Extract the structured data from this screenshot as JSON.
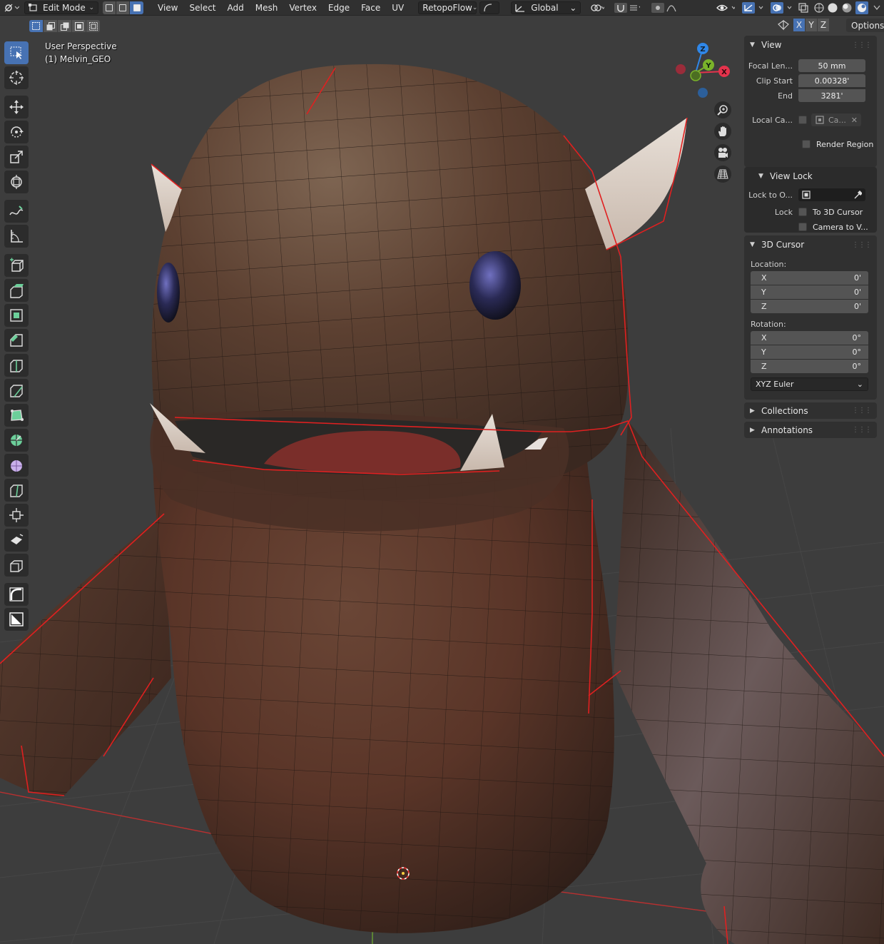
{
  "header": {
    "mode_label": "Edit Mode",
    "menus": [
      "View",
      "Select",
      "Add",
      "Mesh",
      "Vertex",
      "Edge",
      "Face",
      "UV"
    ],
    "addon_dropdown": "RetopoFlow",
    "orientation_dropdown": "Global"
  },
  "tool_header": {
    "axes": [
      "X",
      "Y",
      "Z"
    ],
    "options_label": "Options"
  },
  "viewport": {
    "perspective_label": "User Perspective",
    "object_label": "(1) Melvin_GEO"
  },
  "gizmo": {
    "x_label": "X",
    "y_label": "Y",
    "z_label": "Z",
    "colors": {
      "x": "#e5334c",
      "y": "#7ab32a",
      "z": "#2f87e8"
    }
  },
  "npanel": {
    "view": {
      "title": "View",
      "focal_length_label": "Focal Len...",
      "focal_length_value": "50 mm",
      "clip_start_label": "Clip Start",
      "clip_start_value": "0.00328'",
      "clip_end_label": "End",
      "clip_end_value": "3281'",
      "local_camera_label": "Local Ca...",
      "local_camera_value": "Ca...",
      "render_region_label": "Render Region"
    },
    "view_lock": {
      "title": "View Lock",
      "lock_to_object_label": "Lock to O...",
      "lock_label": "Lock",
      "to_3d_cursor_label": "To 3D Cursor",
      "camera_to_view_label": "Camera to V..."
    },
    "cursor": {
      "title": "3D Cursor",
      "location_label": "Location:",
      "location": [
        {
          "axis": "X",
          "value": "0'"
        },
        {
          "axis": "Y",
          "value": "0'"
        },
        {
          "axis": "Z",
          "value": "0'"
        }
      ],
      "rotation_label": "Rotation:",
      "rotation": [
        {
          "axis": "X",
          "value": "0°"
        },
        {
          "axis": "Y",
          "value": "0°"
        },
        {
          "axis": "Z",
          "value": "0°"
        }
      ],
      "rotation_mode": "XYZ Euler"
    },
    "collections_title": "Collections",
    "annotations_title": "Annotations"
  },
  "colors": {
    "accent": "#4772b3",
    "seam": "#e02020",
    "monster_skin": "#5a3a2c"
  }
}
